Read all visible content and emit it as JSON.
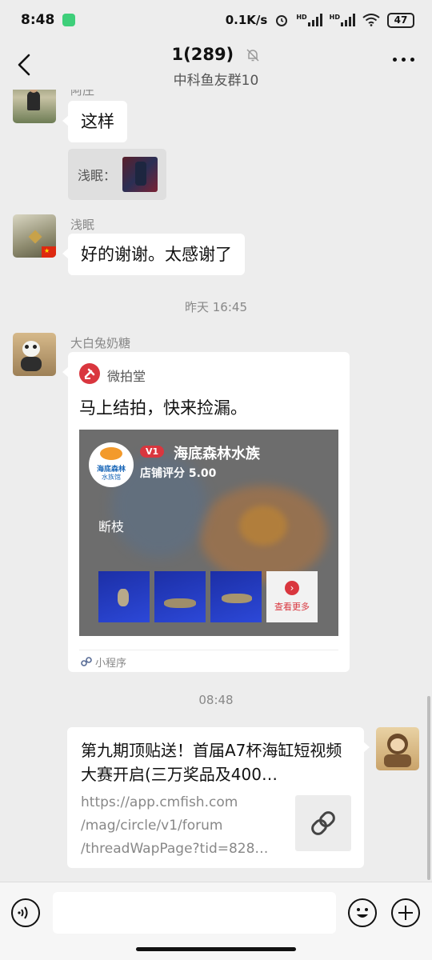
{
  "status_bar": {
    "time": "8:48",
    "network_speed": "0.1K/s",
    "signal_1_label": "HD",
    "signal_2_label": "HD",
    "battery": "47"
  },
  "header": {
    "title": "1(289)",
    "subtitle": "中科鱼友群10"
  },
  "messages": [
    {
      "sender": "阿庄",
      "text": "这样",
      "quote_label": "浅眠："
    },
    {
      "sender": "浅眠",
      "text": "好的谢谢。太感谢了"
    },
    {
      "timestamp": "昨天 16:45"
    },
    {
      "sender": "大白兔奶糖",
      "card": {
        "app_name": "微拍堂",
        "text": "马上结拍，快来捡漏。",
        "shop_level": "V1",
        "shop_name": "海底森林水族",
        "shop_rating": "店铺评分 5.00",
        "shop_logo_text_1": "海底森林",
        "shop_logo_text_2": "水族馆",
        "item_label": "断枝",
        "more_label": "查看更多",
        "footer": "小程序"
      }
    },
    {
      "timestamp": "08:48"
    },
    {
      "link_card": {
        "title": "第九期顶贴送！首届A7杯海缸短视频大赛开启(三万奖品及400…",
        "url_lines": [
          "https://app.cmfish.com",
          "/mag/circle/v1/forum",
          "/threadWapPage?tid=828…"
        ]
      }
    }
  ],
  "colors": {
    "background": "#ededed",
    "bubble": "#ffffff",
    "weipaitang_red": "#d9363e",
    "card_image_bg": "#6d6d6d"
  }
}
